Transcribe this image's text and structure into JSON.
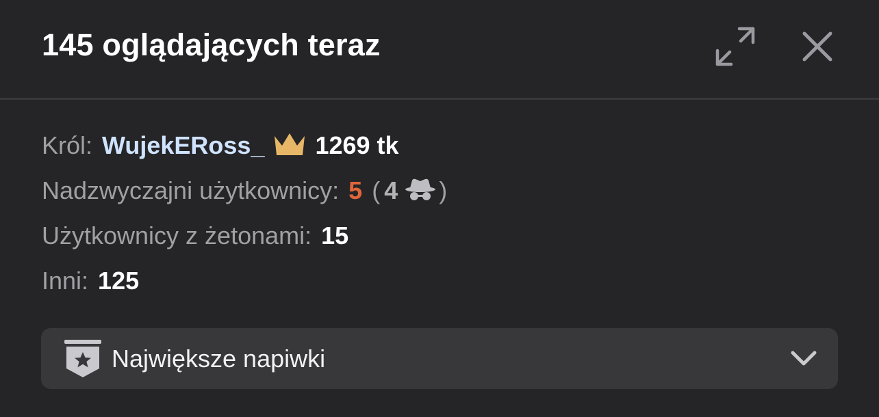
{
  "header": {
    "title": "145 oglądających teraz",
    "expand_icon": "expand-arrows-icon",
    "close_icon": "close-icon"
  },
  "king": {
    "label": "Król:",
    "name": "WujekERoss_",
    "icon": "crown-icon",
    "tokens": "1269 tk"
  },
  "special_users": {
    "label": "Nadzwyczajni użytkownicy:",
    "count": "5",
    "open_paren": "(",
    "hidden_count": "4",
    "hidden_icon": "incognito-spy-icon",
    "close_paren": ")"
  },
  "token_users": {
    "label": "Użytkownicy z żetonami:",
    "count": "15"
  },
  "others": {
    "label": "Inni:",
    "count": "125"
  },
  "top_tips": {
    "label": "Największe napiwki",
    "icon": "star-badge-icon",
    "chevron_icon": "chevron-down-icon",
    "expanded": false
  },
  "colors": {
    "background": "#252527",
    "divider": "#38383b",
    "label_gray": "#a0a0a5",
    "king_name": "#cfe3ff",
    "crown_gold": "#e7b667",
    "special_orange": "#e0663a",
    "dropdown_bg": "#38383b"
  }
}
